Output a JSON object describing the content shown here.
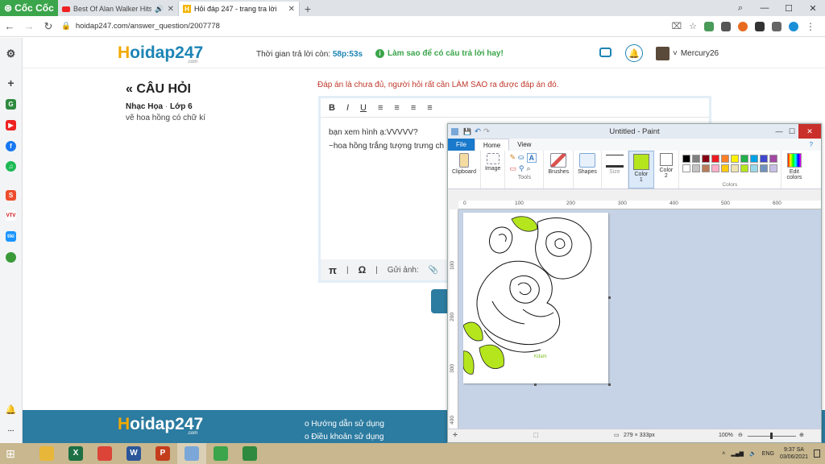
{
  "browser": {
    "brand": "Cốc Cốc",
    "tabs": [
      {
        "title": "Best Of Alan Walker Hits",
        "icon": "youtube-icon",
        "audio_icon": "🔊"
      },
      {
        "title": "Hỏi đáp 247 - trang tra lời",
        "icon": "hoidap-icon"
      }
    ],
    "new_tab": "+",
    "url": "hoidap247.com/answer_question/2007778"
  },
  "site": {
    "logo_prefix": "H",
    "logo_rest": "oidap247",
    "logo_sub": ".com",
    "timer_label": "Thời gian trả lời còn:",
    "timer_value": "58p:53s",
    "howto": "Làm sao để có câu trả lời hay!",
    "username": "Mercury26",
    "user_caret": "˅"
  },
  "question": {
    "heading_icon": "«",
    "heading": "CÂU HỎI",
    "subject": "Nhạc Họa",
    "grade": "Lớp 6",
    "meta_sep": " · ",
    "text": "vẽ hoa hồng có chữ kí"
  },
  "answer": {
    "warning": "Đáp án là chưa đủ, người hỏi rất cần LÀM SAO ra được đáp án đó.",
    "toolbar": [
      "B",
      "I",
      "U"
    ],
    "line1": "bạn xem hình ạ:VVVVV?",
    "line2": "~hoa hồng trắng tượng trưng ch",
    "footer_pi": "π",
    "footer_omega": "Ω",
    "footer_sep": "|",
    "footer_attach": "Gửi ảnh:"
  },
  "footer": {
    "links": [
      "Hướng dẫn sử dụng",
      "Điều khoản sử dụng"
    ],
    "bullet": "o"
  },
  "paint": {
    "title": "Untitled - Paint",
    "tabs": [
      "File",
      "Home",
      "View"
    ],
    "groups": {
      "clipboard": "Clipboard",
      "image": "Image",
      "tools": "Tools",
      "brushes": "Brushes",
      "shapes": "Shapes",
      "size": "Size",
      "color1": "Color 1",
      "color2": "Color 2",
      "colors": "Colors",
      "edit_colors": "Edit colors"
    },
    "ruler_ticks": [
      "0",
      "100",
      "200",
      "300",
      "400",
      "500",
      "600"
    ],
    "vruler_ticks": [
      "100",
      "200",
      "300",
      "400"
    ],
    "canvas_size": "279 × 333px",
    "zoom": "100%",
    "signature": "Kdam",
    "palette": [
      "#000000",
      "#7f7f7f",
      "#880015",
      "#ed1c24",
      "#ff7f27",
      "#fff200",
      "#22b14c",
      "#00a2e8",
      "#3f48cc",
      "#a349a4",
      "#ffffff",
      "#c3c3c3",
      "#b97a57",
      "#ffaec9",
      "#ffc90e",
      "#efe4b0",
      "#b5e61d",
      "#99d9ea",
      "#7092be",
      "#c8bfe7"
    ],
    "color1": "#b5e61d",
    "color2": "#ffffff"
  },
  "taskbar": {
    "apps": [
      {
        "name": "file-explorer",
        "glyph": "",
        "color": "#e8b73a"
      },
      {
        "name": "excel",
        "glyph": "X",
        "color": "#1d7044"
      },
      {
        "name": "chrome",
        "glyph": "",
        "color": "#db4437"
      },
      {
        "name": "word",
        "glyph": "W",
        "color": "#2b579a"
      },
      {
        "name": "powerpoint",
        "glyph": "P",
        "color": "#c43e1c"
      },
      {
        "name": "paint",
        "glyph": "",
        "color": "#7aa7d8"
      },
      {
        "name": "coccoc",
        "glyph": "",
        "color": "#3aa54a"
      },
      {
        "name": "excel-green",
        "glyph": "",
        "color": "#2d8a3e"
      }
    ],
    "lang": "ENG",
    "time": "9:37 SA",
    "date": "03/06/2021"
  }
}
